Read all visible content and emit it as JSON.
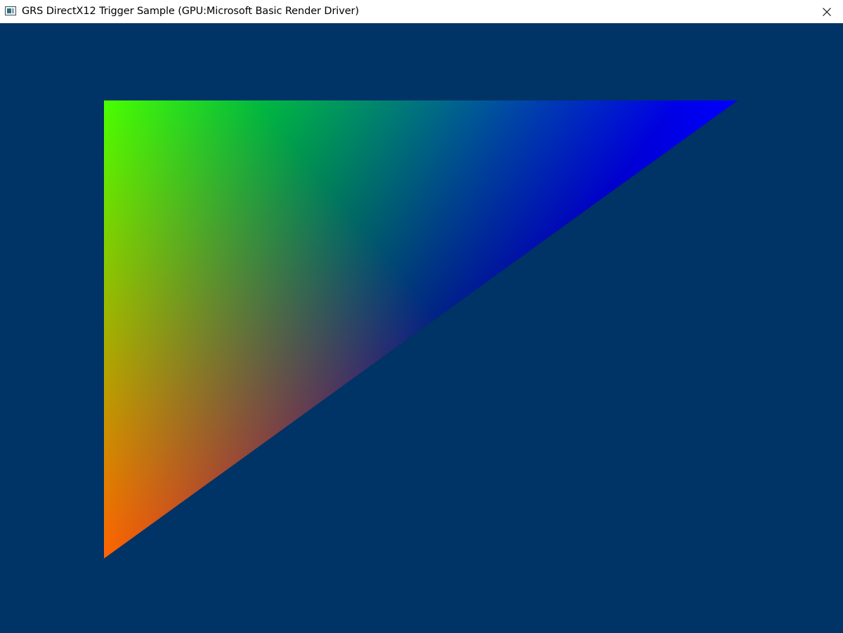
{
  "window": {
    "title": "GRS DirectX12 Trigger Sample (GPU:Microsoft Basic Render Driver)",
    "app_icon": "window-app-icon",
    "close_icon": "close-icon"
  },
  "scene": {
    "clear_color": "#003366",
    "triangle": {
      "vertex_colors": {
        "top_left": "#00ff00",
        "top_right": "#0000ff",
        "bottom_left": "#ff0000"
      }
    }
  }
}
